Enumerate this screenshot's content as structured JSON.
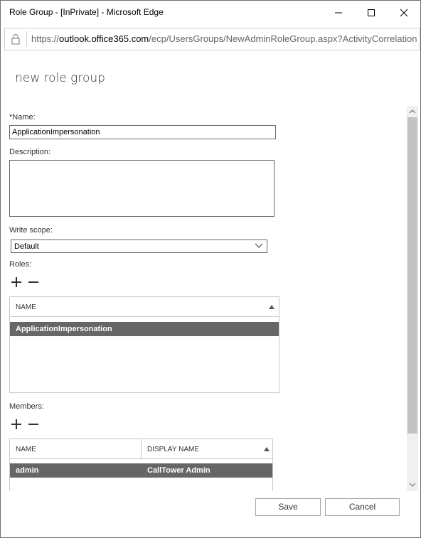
{
  "window": {
    "title": "Role Group - [InPrivate] - Microsoft Edge",
    "minimize_icon": "minimize-icon",
    "maximize_icon": "maximize-icon",
    "close_icon": "close-icon"
  },
  "address_bar": {
    "protocol": "https://",
    "host": "outlook.office365.com",
    "path": "/ecp/UsersGroups/NewAdminRoleGroup.aspx?ActivityCorrelation",
    "lock_icon": "lock-icon"
  },
  "dialog": {
    "heading": "new role group",
    "name_label": "*Name:",
    "name_value": "ApplicationImpersonation",
    "description_label": "Description:",
    "description_value": "",
    "write_scope_label": "Write scope:",
    "write_scope_value": "Default",
    "roles_label": "Roles:",
    "roles_table": {
      "columns": [
        "NAME"
      ],
      "sort_icon": "sort-ascending-icon",
      "rows": [
        {
          "name": "ApplicationImpersonation",
          "selected": true
        }
      ]
    },
    "members_label": "Members:",
    "members_table": {
      "columns": [
        "NAME",
        "DISPLAY NAME"
      ],
      "sort_icon": "sort-ascending-icon",
      "rows": [
        {
          "name": "admin",
          "display_name": "CallTower Admin",
          "selected": true
        }
      ]
    },
    "save_label": "Save",
    "cancel_label": "Cancel"
  },
  "colors": {
    "selected_row": "#666666",
    "scrollbar_thumb": "#c2c2c2"
  }
}
